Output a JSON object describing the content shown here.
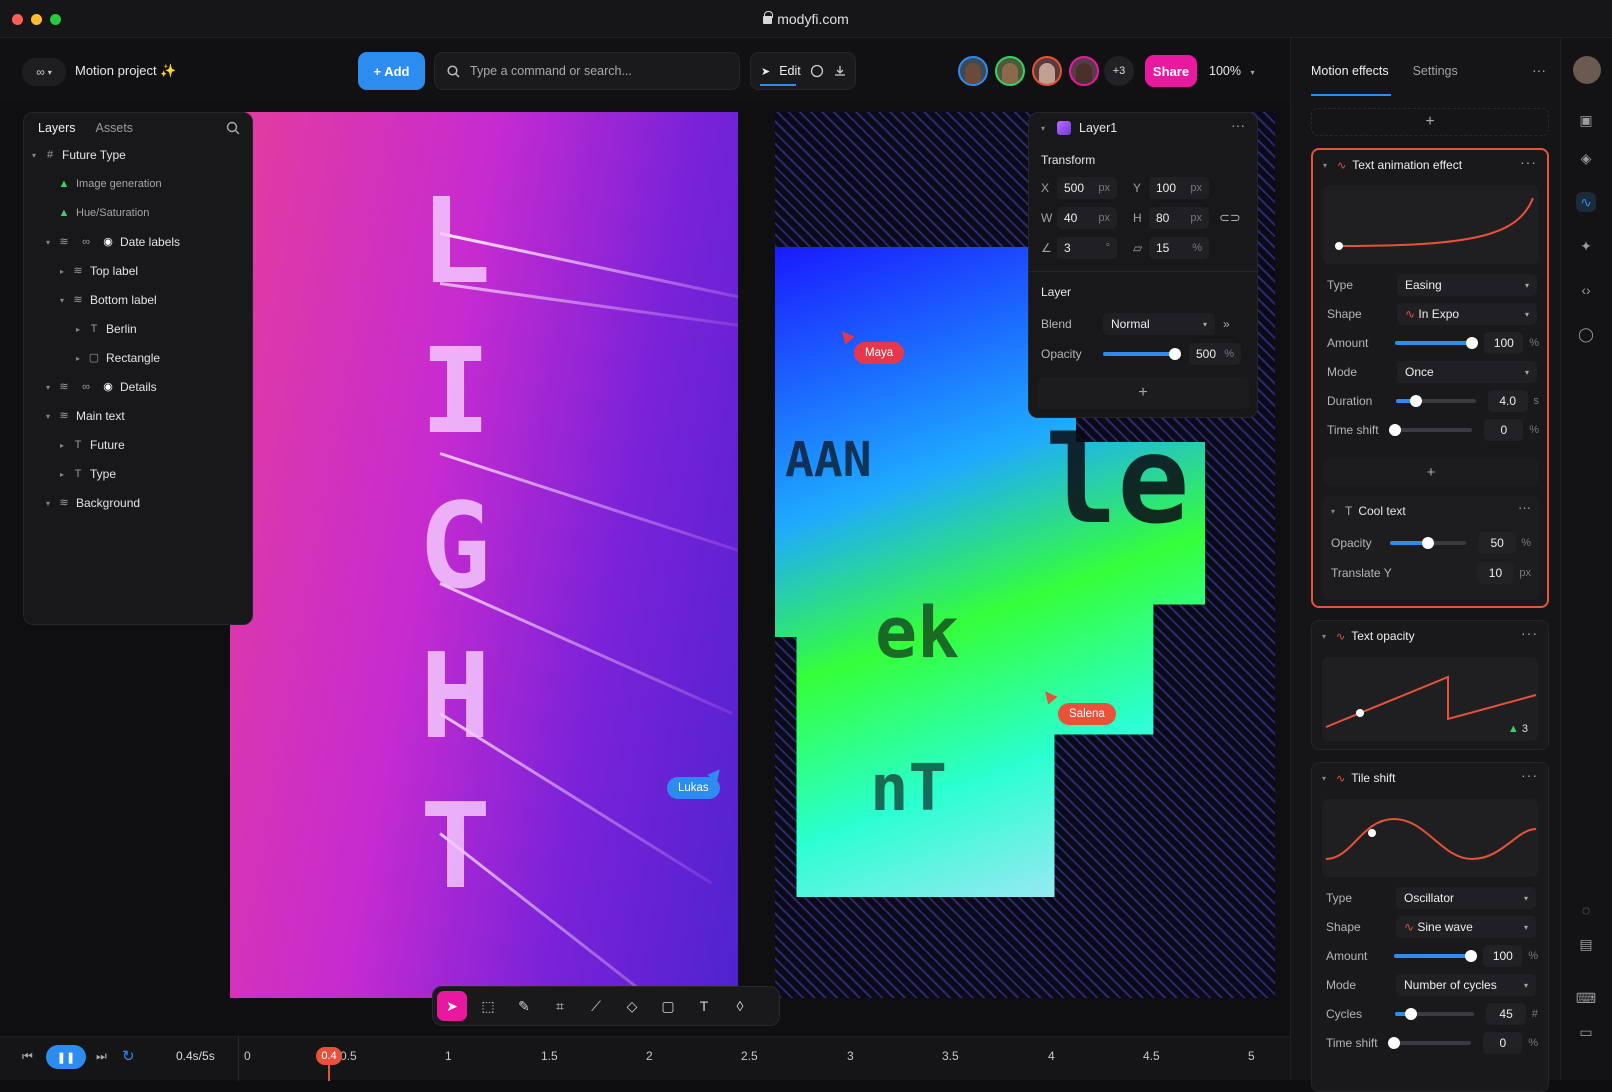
{
  "browser": {
    "url": "modyfi.com"
  },
  "header": {
    "project_name": "Motion project ✨",
    "add_label": "+ Add",
    "search_placeholder": "Type a command or search...",
    "edit_label": "Edit",
    "more_avatars": "+3",
    "share_label": "Share",
    "zoom": "100%"
  },
  "layers_panel": {
    "tabs": [
      "Layers",
      "Assets"
    ],
    "items": [
      {
        "label": "Future Type",
        "depth": 0
      },
      {
        "label": "Image generation",
        "depth": 1
      },
      {
        "label": "Hue/Saturation",
        "depth": 1
      },
      {
        "label": "Date labels",
        "depth": 1
      },
      {
        "label": "Top label",
        "depth": 2
      },
      {
        "label": "Bottom label",
        "depth": 2
      },
      {
        "label": "Berlin",
        "depth": 3
      },
      {
        "label": "Rectangle",
        "depth": 3
      },
      {
        "label": "Details",
        "depth": 1
      },
      {
        "label": "Main text",
        "depth": 1
      },
      {
        "label": "Future",
        "depth": 2
      },
      {
        "label": "Type",
        "depth": 2
      },
      {
        "label": "Background",
        "depth": 1
      }
    ]
  },
  "artboard1": {
    "letters": [
      "L",
      "I",
      "G",
      "H",
      "T"
    ]
  },
  "collaborators": {
    "maya": "Maya",
    "salena": "Salena",
    "lukas": "Lukas"
  },
  "layer_panel": {
    "title": "Layer1",
    "transform_label": "Transform",
    "x": "500",
    "y": "100",
    "w": "40",
    "h": "80",
    "rotation": "3",
    "skew": "15",
    "unit_px": "px",
    "unit_deg": "°",
    "unit_pct": "%",
    "layer_label": "Layer",
    "blend_label": "Blend",
    "blend_value": "Normal",
    "opacity_label": "Opacity",
    "opacity_value": "500",
    "opacity_level": 0.95
  },
  "right_panel": {
    "tabs": [
      "Motion effects",
      "Settings"
    ],
    "text_animation": {
      "title": "Text animation effect",
      "type_label": "Type",
      "type_value": "Easing",
      "shape_label": "Shape",
      "shape_value": "In Expo",
      "amount_label": "Amount",
      "amount_value": "100",
      "amount_level": 1.0,
      "mode_label": "Mode",
      "mode_value": "Once",
      "duration_label": "Duration",
      "duration_value": "4.0",
      "duration_unit": "s",
      "duration_level": 0.25,
      "timeshift_label": "Time shift",
      "timeshift_value": "0",
      "timeshift_level": 0.0
    },
    "cool_text": {
      "title": "Cool text",
      "opacity_label": "Opacity",
      "opacity_value": "50",
      "opacity_level": 0.5,
      "translate_label": "Translate Y",
      "translate_value": "10",
      "translate_unit": "px"
    },
    "text_opacity": {
      "title": "Text opacity",
      "count": "3"
    },
    "tile_shift": {
      "title": "Tile shift",
      "type_label": "Type",
      "type_value": "Oscillator",
      "shape_label": "Shape",
      "shape_value": "Sine wave",
      "amount_label": "Amount",
      "amount_value": "100",
      "amount_level": 1.0,
      "mode_label": "Mode",
      "mode_value": "Number of cycles",
      "cycles_label": "Cycles",
      "cycles_value": "45",
      "cycles_unit": "#",
      "cycles_level": 0.2,
      "timeshift_label": "Time shift",
      "timeshift_value": "0",
      "timeshift_level": 0.0
    }
  },
  "timeline": {
    "time": "0.4s/5s",
    "playhead": "0.4",
    "ticks": [
      "0",
      "0.5",
      "1",
      "1.5",
      "2",
      "2.5",
      "3",
      "3.5",
      "4",
      "4.5",
      "5"
    ]
  },
  "colors": {
    "accent": "#2d8cf0",
    "share": "#e8199e",
    "active_card": "#e8513a"
  }
}
